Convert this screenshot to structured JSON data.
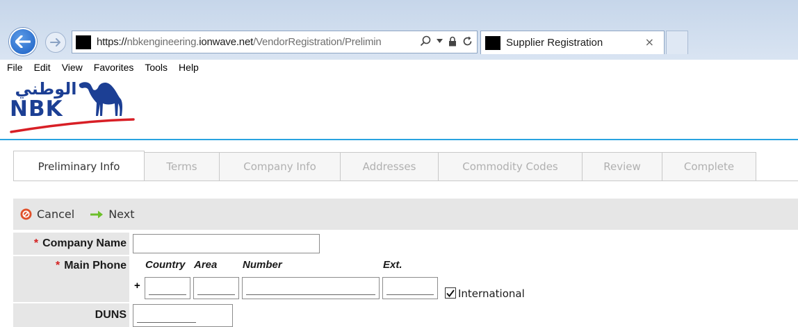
{
  "browser": {
    "url_scheme": "https://",
    "url_pre": "nbkengineering.",
    "url_domain": "ionwave.net",
    "url_path": "/VendorRegistration/Prelimin",
    "tab_title": "Supplier Registration",
    "tab_close": "×",
    "menu": [
      "File",
      "Edit",
      "View",
      "Favorites",
      "Tools",
      "Help"
    ]
  },
  "logo": {
    "arabic_text": "الوطني",
    "latin_text": "NBK",
    "brand_color": "#1c3f94",
    "swoosh_color": "#d81f26"
  },
  "wizard": {
    "tabs": [
      "Preliminary Info",
      "Terms",
      "Company Info",
      "Addresses",
      "Commodity Codes",
      "Review",
      "Complete"
    ],
    "active_index": 0
  },
  "toolbar": {
    "cancel_label": "Cancel",
    "next_label": "Next"
  },
  "form": {
    "required_mark": "*",
    "company_name_label": "Company Name",
    "company_name_value": "",
    "main_phone_label": "Main Phone",
    "phone_country_header": "Country",
    "phone_area_header": "Area",
    "phone_number_header": "Number",
    "phone_ext_header": "Ext.",
    "phone_plus": "+",
    "international_label": "International",
    "international_checked": true,
    "duns_label": "DUNS"
  },
  "colors": {
    "accent_line": "#29a3e0",
    "required": "#d42020",
    "cancel_icon": "#e0502a",
    "next_icon": "#6cbf2a"
  }
}
